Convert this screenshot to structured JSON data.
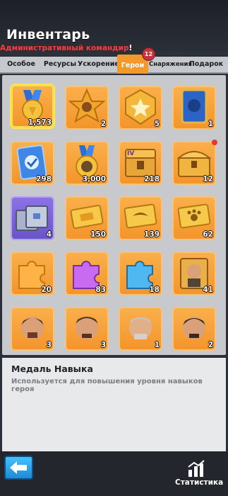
{
  "header": {
    "title": "Инвентарь",
    "subtitle": "Административный командир",
    "subtitle_mark": "!"
  },
  "tabs": [
    {
      "label": "Особое"
    },
    {
      "label": "Ресурсы"
    },
    {
      "label": "Ускорение"
    },
    {
      "label": "Герои"
    },
    {
      "label": "Снаряжения"
    },
    {
      "label": "Подарок"
    }
  ],
  "tab_badge": "12",
  "items": [
    {
      "icon": "gold-medal-icon",
      "count": "1,573"
    },
    {
      "icon": "star-badge-icon",
      "count": "2"
    },
    {
      "icon": "gold-badge-icon",
      "count": "5"
    },
    {
      "icon": "blue-card-icon",
      "count": "1"
    },
    {
      "icon": "checkmark-card-icon",
      "count": "298"
    },
    {
      "icon": "gorilla-medal-icon",
      "count": "3,000"
    },
    {
      "icon": "hero-chest-icon",
      "count": "218"
    },
    {
      "icon": "treasure-chest-icon",
      "count": "12"
    },
    {
      "icon": "purple-chest-icon",
      "count": "4"
    },
    {
      "icon": "gold-ticket-icon",
      "count": "150"
    },
    {
      "icon": "wing-ticket-icon",
      "count": "139"
    },
    {
      "icon": "paw-ticket-icon",
      "count": "62"
    },
    {
      "icon": "orange-puzzle-icon",
      "count": "20"
    },
    {
      "icon": "purple-puzzle-icon",
      "count": "83"
    },
    {
      "icon": "blue-puzzle-icon",
      "count": "18"
    },
    {
      "icon": "hero-portrait-puzzle-icon",
      "count": "41"
    },
    {
      "icon": "hero-face-icon",
      "count": "3"
    },
    {
      "icon": "hero-face-icon",
      "count": "3"
    },
    {
      "icon": "hero-face-icon",
      "count": "1"
    },
    {
      "icon": "hero-face-icon",
      "count": "2"
    }
  ],
  "details": {
    "title": "Медаль Навыка",
    "description": "Используется для повышения уровня навыков героя"
  },
  "footer": {
    "stats_label": "Статистика"
  },
  "colors": {
    "tab_active": "#f2992b",
    "cell": "#f3942a",
    "subtitle": "#ff3a3a"
  }
}
